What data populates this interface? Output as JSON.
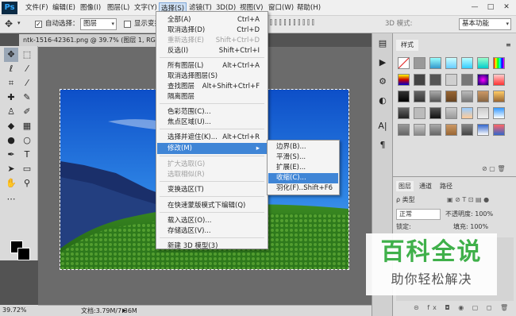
{
  "menubar": {
    "logo": "Ps",
    "items": [
      "文件(F)",
      "编辑(E)",
      "图像(I)",
      "图层(L)",
      "文字(Y)",
      "选择(S)",
      "滤镜(T)",
      "3D(D)",
      "视图(V)",
      "窗口(W)",
      "帮助(H)"
    ],
    "win_buttons": [
      "—",
      "□",
      "✕"
    ]
  },
  "options": {
    "auto_select_label": "自动选择：",
    "auto_select_value": "图层",
    "show_transform_label": "显示变换控",
    "mode_3d": "3D 模式:",
    "workspace": "基本功能"
  },
  "document": {
    "tab_title": "ntk-1516-42361.png @ 39.7% (图层 1, RG",
    "zoom": "39.72%",
    "doc_info": "文档:3.79M/7.36M"
  },
  "select_menu": {
    "items": [
      {
        "label": "全部(A)",
        "shortcut": "Ctrl+A",
        "disabled": false
      },
      {
        "label": "取消选择(D)",
        "shortcut": "Ctrl+D",
        "disabled": false
      },
      {
        "label": "重新选择(E)",
        "shortcut": "Shift+Ctrl+D",
        "disabled": true
      },
      {
        "label": "反选(I)",
        "shortcut": "Shift+Ctrl+I",
        "disabled": false
      },
      {
        "label": "所有图层(L)",
        "shortcut": "Alt+Ctrl+A",
        "disabled": false
      },
      {
        "label": "取消选择图层(S)",
        "shortcut": "",
        "disabled": false
      },
      {
        "label": "查找图层",
        "shortcut": "Alt+Shift+Ctrl+F",
        "disabled": false
      },
      {
        "label": "隔离图层",
        "shortcut": "",
        "disabled": false
      },
      {
        "label": "色彩范围(C)...",
        "shortcut": "",
        "disabled": false
      },
      {
        "label": "焦点区域(U)...",
        "shortcut": "",
        "disabled": false
      },
      {
        "label": "选择并遮住(K)...",
        "shortcut": "Alt+Ctrl+R",
        "disabled": false
      },
      {
        "label": "修改(M)",
        "shortcut": "",
        "disabled": false
      },
      {
        "label": "扩大选取(G)",
        "shortcut": "",
        "disabled": true
      },
      {
        "label": "选取相似(R)",
        "shortcut": "",
        "disabled": true
      },
      {
        "label": "变换选区(T)",
        "shortcut": "",
        "disabled": false
      },
      {
        "label": "在快速蒙版模式下编辑(Q)",
        "shortcut": "",
        "disabled": false
      },
      {
        "label": "载入选区(O)...",
        "shortcut": "",
        "disabled": false
      },
      {
        "label": "存储选区(V)...",
        "shortcut": "",
        "disabled": false
      },
      {
        "label": "新建 3D 模型(3)",
        "shortcut": "",
        "disabled": false
      }
    ],
    "submenu_arrow": "▸"
  },
  "modify_submenu": {
    "items": [
      {
        "label": "边界(B)...",
        "shortcut": ""
      },
      {
        "label": "平滑(S)...",
        "shortcut": ""
      },
      {
        "label": "扩展(E)...",
        "shortcut": ""
      },
      {
        "label": "收缩(C)...",
        "shortcut": ""
      },
      {
        "label": "羽化(F)...",
        "shortcut": "Shift+F6"
      }
    ]
  },
  "panels": {
    "styles_tab": "样式",
    "layers_tabs": [
      "图层",
      "通道",
      "路径"
    ],
    "kind_label": "ρ 类型",
    "blend_mode": "正常",
    "opacity_label": "不透明度: 100%",
    "lock_label": "锁定:",
    "fill_label": "填充: 100%"
  },
  "watermark": {
    "title": "百科全说",
    "subtitle": "助你轻松解决"
  },
  "colors": {
    "menu_highlight": "#3f85d6",
    "watermark_green": "#3fb04a"
  }
}
